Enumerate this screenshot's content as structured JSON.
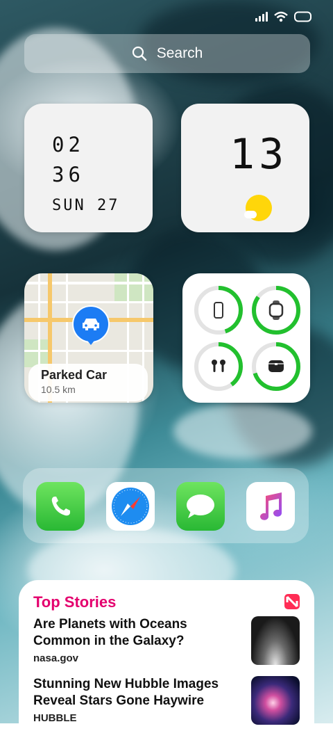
{
  "search": {
    "placeholder": "Search"
  },
  "clock_widget": {
    "hour": "02",
    "minute": "36",
    "date": "SUN 27"
  },
  "date_widget": {
    "day_number": "13"
  },
  "map_widget": {
    "title": "Parked Car",
    "distance": "10.5 km"
  },
  "battery_widget": {
    "devices": [
      {
        "name": "iphone",
        "level": 0.45
      },
      {
        "name": "watch",
        "level": 0.85
      },
      {
        "name": "airpods",
        "level": 0.4
      },
      {
        "name": "case",
        "level": 0.7
      }
    ],
    "ring_color": "#22c02e"
  },
  "dock": {
    "apps": [
      "Phone",
      "Safari",
      "Messages",
      "Music"
    ]
  },
  "news": {
    "header": "Top Stories",
    "stories": [
      {
        "headline": "Are Planets with Oceans Common in the Galaxy?",
        "source": "nasa.gov"
      },
      {
        "headline": "Stunning New Hubble Images Reveal Stars Gone Haywire",
        "source": "HUBBLE"
      }
    ]
  },
  "colors": {
    "accent": "#e4006e",
    "pin": "#1c7cf4"
  }
}
